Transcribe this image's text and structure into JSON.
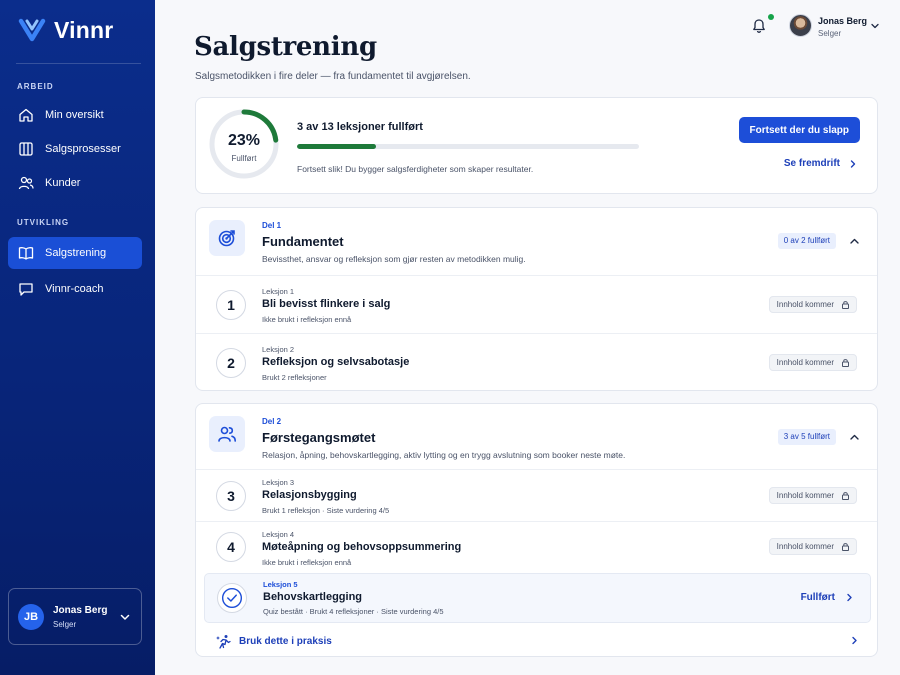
{
  "brand": {
    "name": "Vinnr"
  },
  "sidebar": {
    "sections": [
      {
        "title": "ARBEID"
      },
      {
        "title": "UTVIKLING"
      }
    ],
    "items": [
      {
        "label": "Min oversikt",
        "icon": "home-icon"
      },
      {
        "label": "Salgsprosesser",
        "icon": "columns-icon"
      },
      {
        "label": "Kunder",
        "icon": "users-icon"
      },
      {
        "label": "Salgstrening",
        "icon": "book-icon",
        "active": true
      },
      {
        "label": "Vinnr-coach",
        "icon": "chat-icon"
      }
    ],
    "user": {
      "initials": "JB",
      "name": "Jonas Berg",
      "role": "Selger"
    }
  },
  "header": {
    "user": {
      "name": "Jonas Berg",
      "role": "Selger"
    },
    "notification_dot_color": "#16a34a"
  },
  "page": {
    "title": "Salgstrening",
    "subtitle": "Salgsmetodikken i fire deler — fra fundamentet til avgjørelsen."
  },
  "progress": {
    "percent_label": "23%",
    "percent": 23,
    "ring_label": "Fullført",
    "summary": "3 av 13 leksjoner fullført",
    "note": "Fortsett slik! Du bygger salgsferdigheter som skaper resultater.",
    "continue_button": "Fortsett der du slapp",
    "view_progress_link": "Se fremdrift"
  },
  "sections": [
    {
      "kicker": "Del 1",
      "title": "Fundamentet",
      "description": "Bevissthet, ansvar og refleksjon som gjør resten av metodikken mulig.",
      "badge": "0 av 2 fullført",
      "icon": "target-icon",
      "lessons": [
        {
          "number": "1",
          "kicker": "Leksjon 1",
          "title": "Bli bevisst flinkere i salg",
          "meta": "Ikke brukt i refleksjon ennå",
          "status": "Innhold kommer"
        },
        {
          "number": "2",
          "kicker": "Leksjon 2",
          "title": "Refleksjon og selvsabotasje",
          "meta": "Brukt 2 refleksjoner",
          "status": "Innhold kommer"
        }
      ]
    },
    {
      "kicker": "Del 2",
      "title": "Førstegangsmøtet",
      "description": "Relasjon, åpning, behovskartlegging, aktiv lytting og en trygg avslutning som booker neste møte.",
      "badge": "3 av 5 fullført",
      "icon": "people-icon",
      "lessons": [
        {
          "number": "3",
          "kicker": "Leksjon 3",
          "title": "Relasjonsbygging",
          "meta": "Brukt 1 refleksjon · Siste vurdering 4/5",
          "status": "Innhold kommer"
        },
        {
          "number": "4",
          "kicker": "Leksjon 4",
          "title": "Møteåpning og behovsoppsummering",
          "meta": "Ikke brukt i refleksjon ennå",
          "status": "Innhold kommer"
        },
        {
          "number": "",
          "kicker": "Leksjon 5",
          "title": "Behovskartlegging",
          "meta": "Quiz bestått · Brukt 4 refleksjoner · Siste vurdering 4/5",
          "status": "Fullført"
        }
      ],
      "practice_link": "Bruk dette i praksis"
    }
  ],
  "colors": {
    "sidebar": "#0b2d8c",
    "accent": "#1d4ed8",
    "progress": "#1e7a3a"
  }
}
